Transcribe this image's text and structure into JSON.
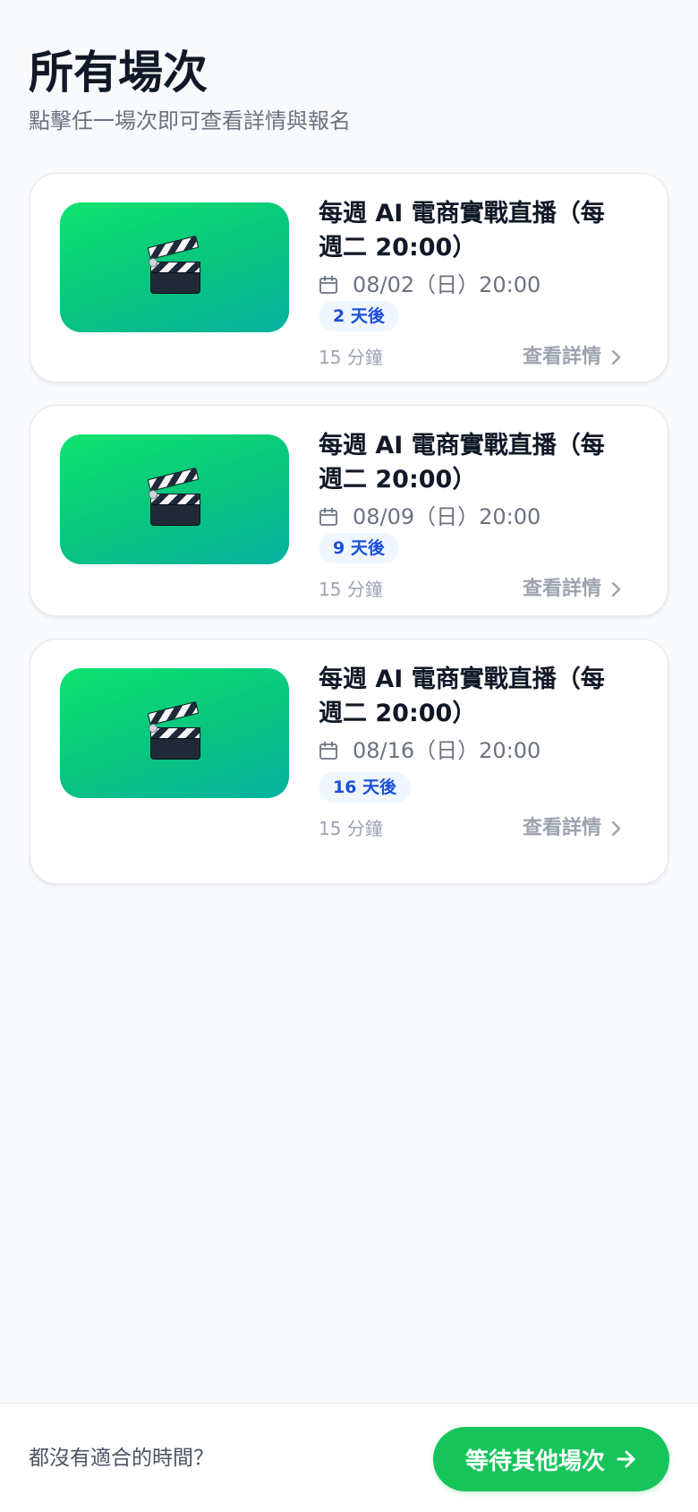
{
  "header": {
    "title": "所有場次",
    "subtitle": "點擊任一場次即可查看詳情與報名"
  },
  "sessions": [
    {
      "title": "每週 AI 電商實戰直播（每週二 20:00）",
      "date": "08/02（日）20:00",
      "countdown": "2 天後",
      "duration": "15 分鐘",
      "details_label": "查看詳情",
      "thumbnail_icon": "clapper-board-icon"
    },
    {
      "title": "每週 AI 電商實戰直播（每週二 20:00）",
      "date": "08/09（日）20:00",
      "countdown": "9 天後",
      "duration": "15 分鐘",
      "details_label": "查看詳情",
      "thumbnail_icon": "clapper-board-icon"
    },
    {
      "title": "每週 AI 電商實戰直播（每週二 20:00）",
      "date": "08/16（日）20:00",
      "countdown": "16 天後",
      "duration": "15 分鐘",
      "details_label": "查看詳情",
      "thumbnail_icon": "clapper-board-icon"
    }
  ],
  "footer": {
    "prompt": "都沒有適合的時間？",
    "button_label": "等待其他場次"
  },
  "colors": {
    "accent": "#16c45a",
    "badge_text": "#1d4ed8",
    "badge_bg": "#eff6ff",
    "thumbnail_gradient_start": "#0ee36f",
    "thumbnail_gradient_end": "#06b3a1"
  }
}
